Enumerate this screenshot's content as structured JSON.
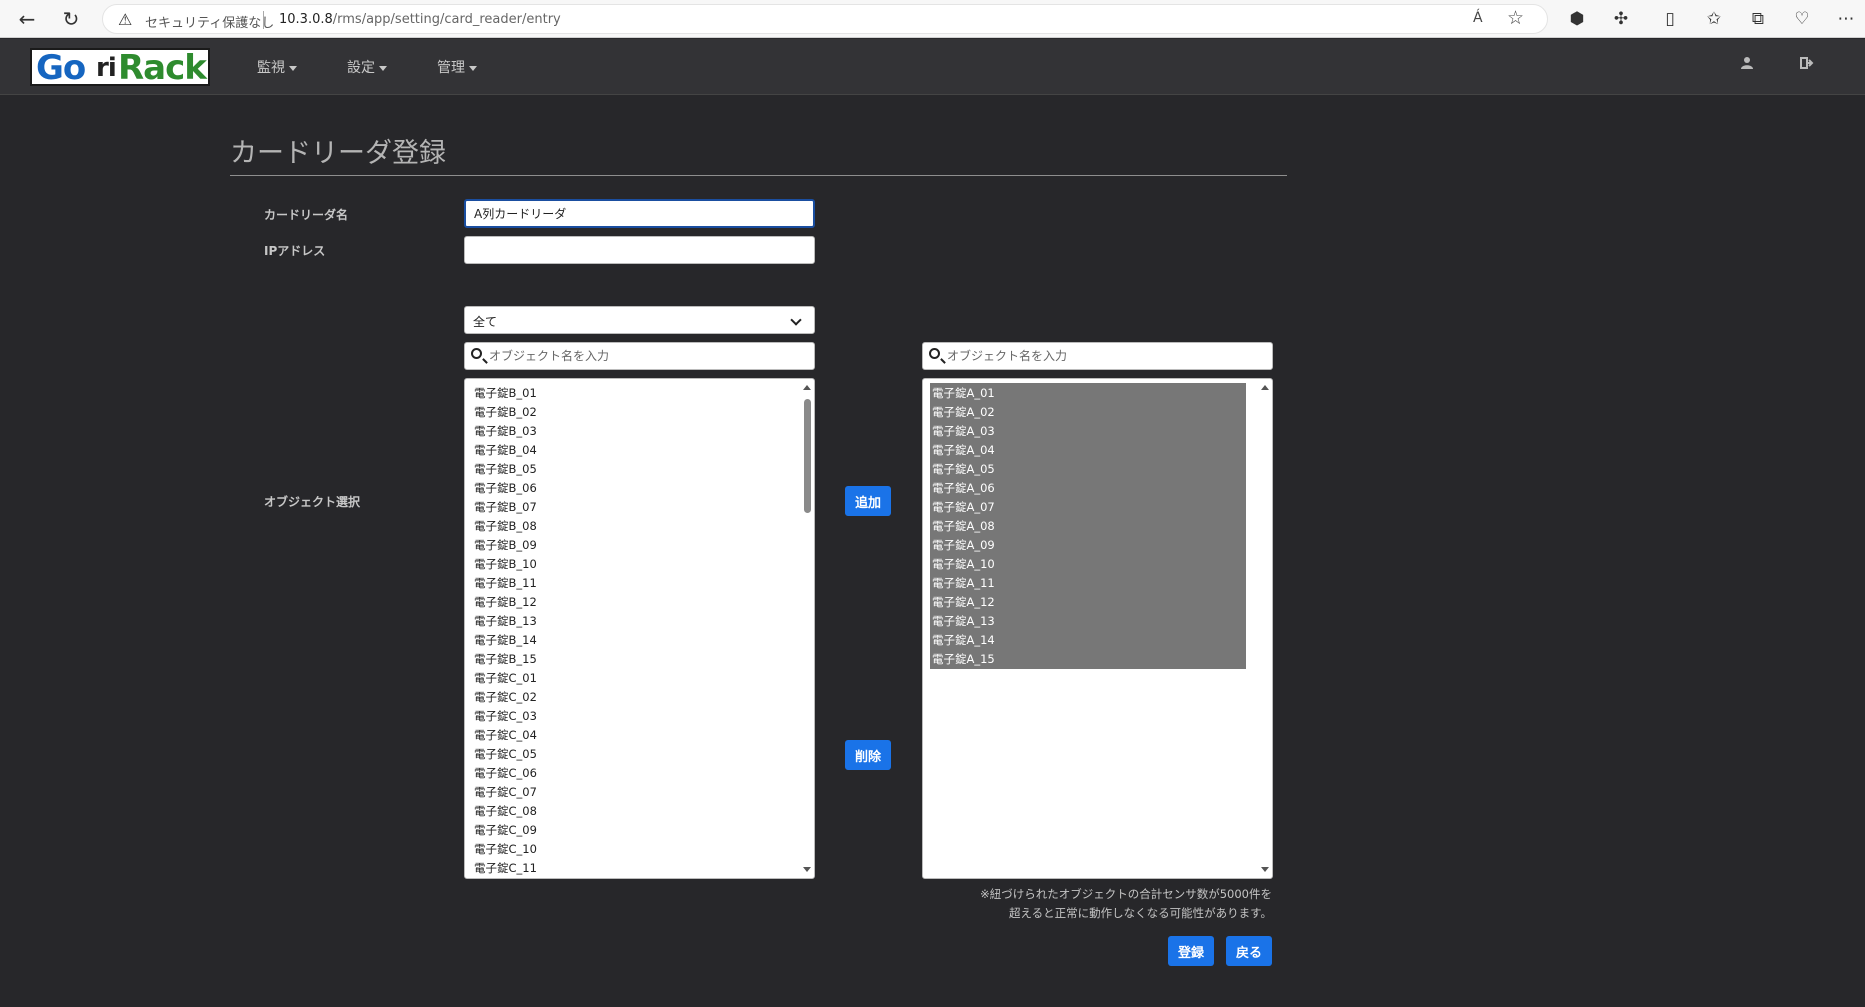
{
  "browser": {
    "security_text": "セキュリティ保護なし",
    "url_host": "10.3.0.8",
    "url_path": "/rms/app/setting/card_reader/entry",
    "read_aloud": "Á",
    "back": "←",
    "reload": "↻"
  },
  "navbar": {
    "logo": {
      "go": "Go",
      "ri": "ri",
      "rack": "Rack"
    },
    "menus": [
      {
        "label": "監視"
      },
      {
        "label": "設定"
      },
      {
        "label": "管理"
      }
    ],
    "user_icon": "user-icon",
    "logout_icon": "sign-out-icon"
  },
  "page": {
    "title": "カードリーダ登録"
  },
  "form": {
    "reader_name_label": "カードリーダ名",
    "reader_name_value": "A列カードリーダ",
    "ip_label": "IPアドレス",
    "ip_value": "",
    "object_select_label": "オブジェクト選択",
    "filter_selected": "全て",
    "search_placeholder": "オブジェクト名を入力",
    "available_objects": [
      "電子錠B_01",
      "電子錠B_02",
      "電子錠B_03",
      "電子錠B_04",
      "電子錠B_05",
      "電子錠B_06",
      "電子錠B_07",
      "電子錠B_08",
      "電子錠B_09",
      "電子錠B_10",
      "電子錠B_11",
      "電子錠B_12",
      "電子錠B_13",
      "電子錠B_14",
      "電子錠B_15",
      "電子錠C_01",
      "電子錠C_02",
      "電子錠C_03",
      "電子錠C_04",
      "電子錠C_05",
      "電子錠C_06",
      "電子錠C_07",
      "電子錠C_08",
      "電子錠C_09",
      "電子錠C_10",
      "電子錠C_11"
    ],
    "selected_objects": [
      "電子錠A_01",
      "電子錠A_02",
      "電子錠A_03",
      "電子錠A_04",
      "電子錠A_05",
      "電子錠A_06",
      "電子錠A_07",
      "電子錠A_08",
      "電子錠A_09",
      "電子錠A_10",
      "電子錠A_11",
      "電子錠A_12",
      "電子錠A_13",
      "電子錠A_14",
      "電子錠A_15"
    ],
    "add_button": "追加",
    "remove_button": "削除",
    "note_line1": "※紐づけられたオブジェクトの合計センサ数が5000件を",
    "note_line2": "超えると正常に動作しなくなる可能性があります。",
    "register_button": "登録",
    "back_button": "戻る"
  },
  "colors": {
    "background": "#27272a",
    "navbar": "#333336",
    "primary_button": "#1a73e8",
    "selected_item": "#777777"
  }
}
